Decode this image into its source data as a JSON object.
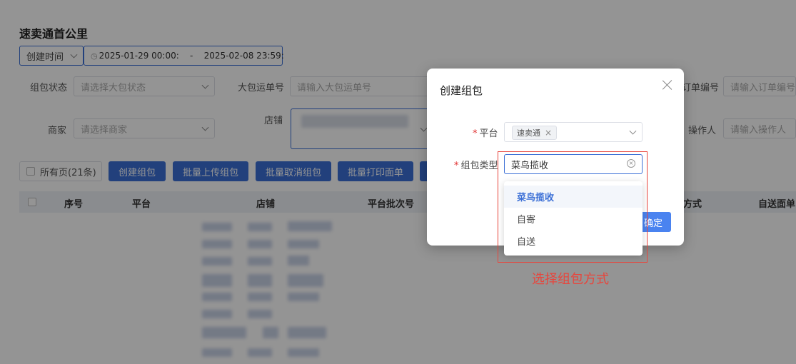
{
  "page": {
    "title": "速卖通首公里",
    "date_type": "创建时间",
    "date_range": "2025-01-29 00:00:    -    2025-02-08 23:59:",
    "filters": {
      "bag_status_label": "组包状态",
      "bag_status_placeholder": "请选择大包状态",
      "big_bag_no_label": "大包运单号",
      "big_bag_no_placeholder": "请输入大包运单号",
      "order_no_label": "订单编号",
      "order_no_placeholder": "请输入订单编号",
      "merchant_label": "商家",
      "merchant_placeholder": "请选择商家",
      "store_label": "店铺",
      "operator_label": "操作人",
      "operator_placeholder": "请输入操作人"
    },
    "toolbar": {
      "all_pages": "所有页(21条)",
      "create_bag": "创建组包",
      "batch_upload": "批量上传组包",
      "batch_cancel": "批量取消组包",
      "batch_print": "批量打印面单"
    },
    "table": {
      "headers": [
        "序号",
        "平台",
        "店铺",
        "平台批次号",
        "方式",
        "自送面单"
      ]
    }
  },
  "dialog": {
    "title": "创建组包",
    "platform_label": "平台",
    "platform_tag": "速卖通",
    "bag_type_label": "组包类型",
    "bag_type_value": "菜鸟揽收",
    "options": [
      "菜鸟揽收",
      "自寄",
      "自送"
    ],
    "confirm_label": "确定"
  },
  "annotation": "选择组包方式",
  "colors": {
    "primary": "#3b6fd6",
    "annotation_red": "#e8453c"
  }
}
